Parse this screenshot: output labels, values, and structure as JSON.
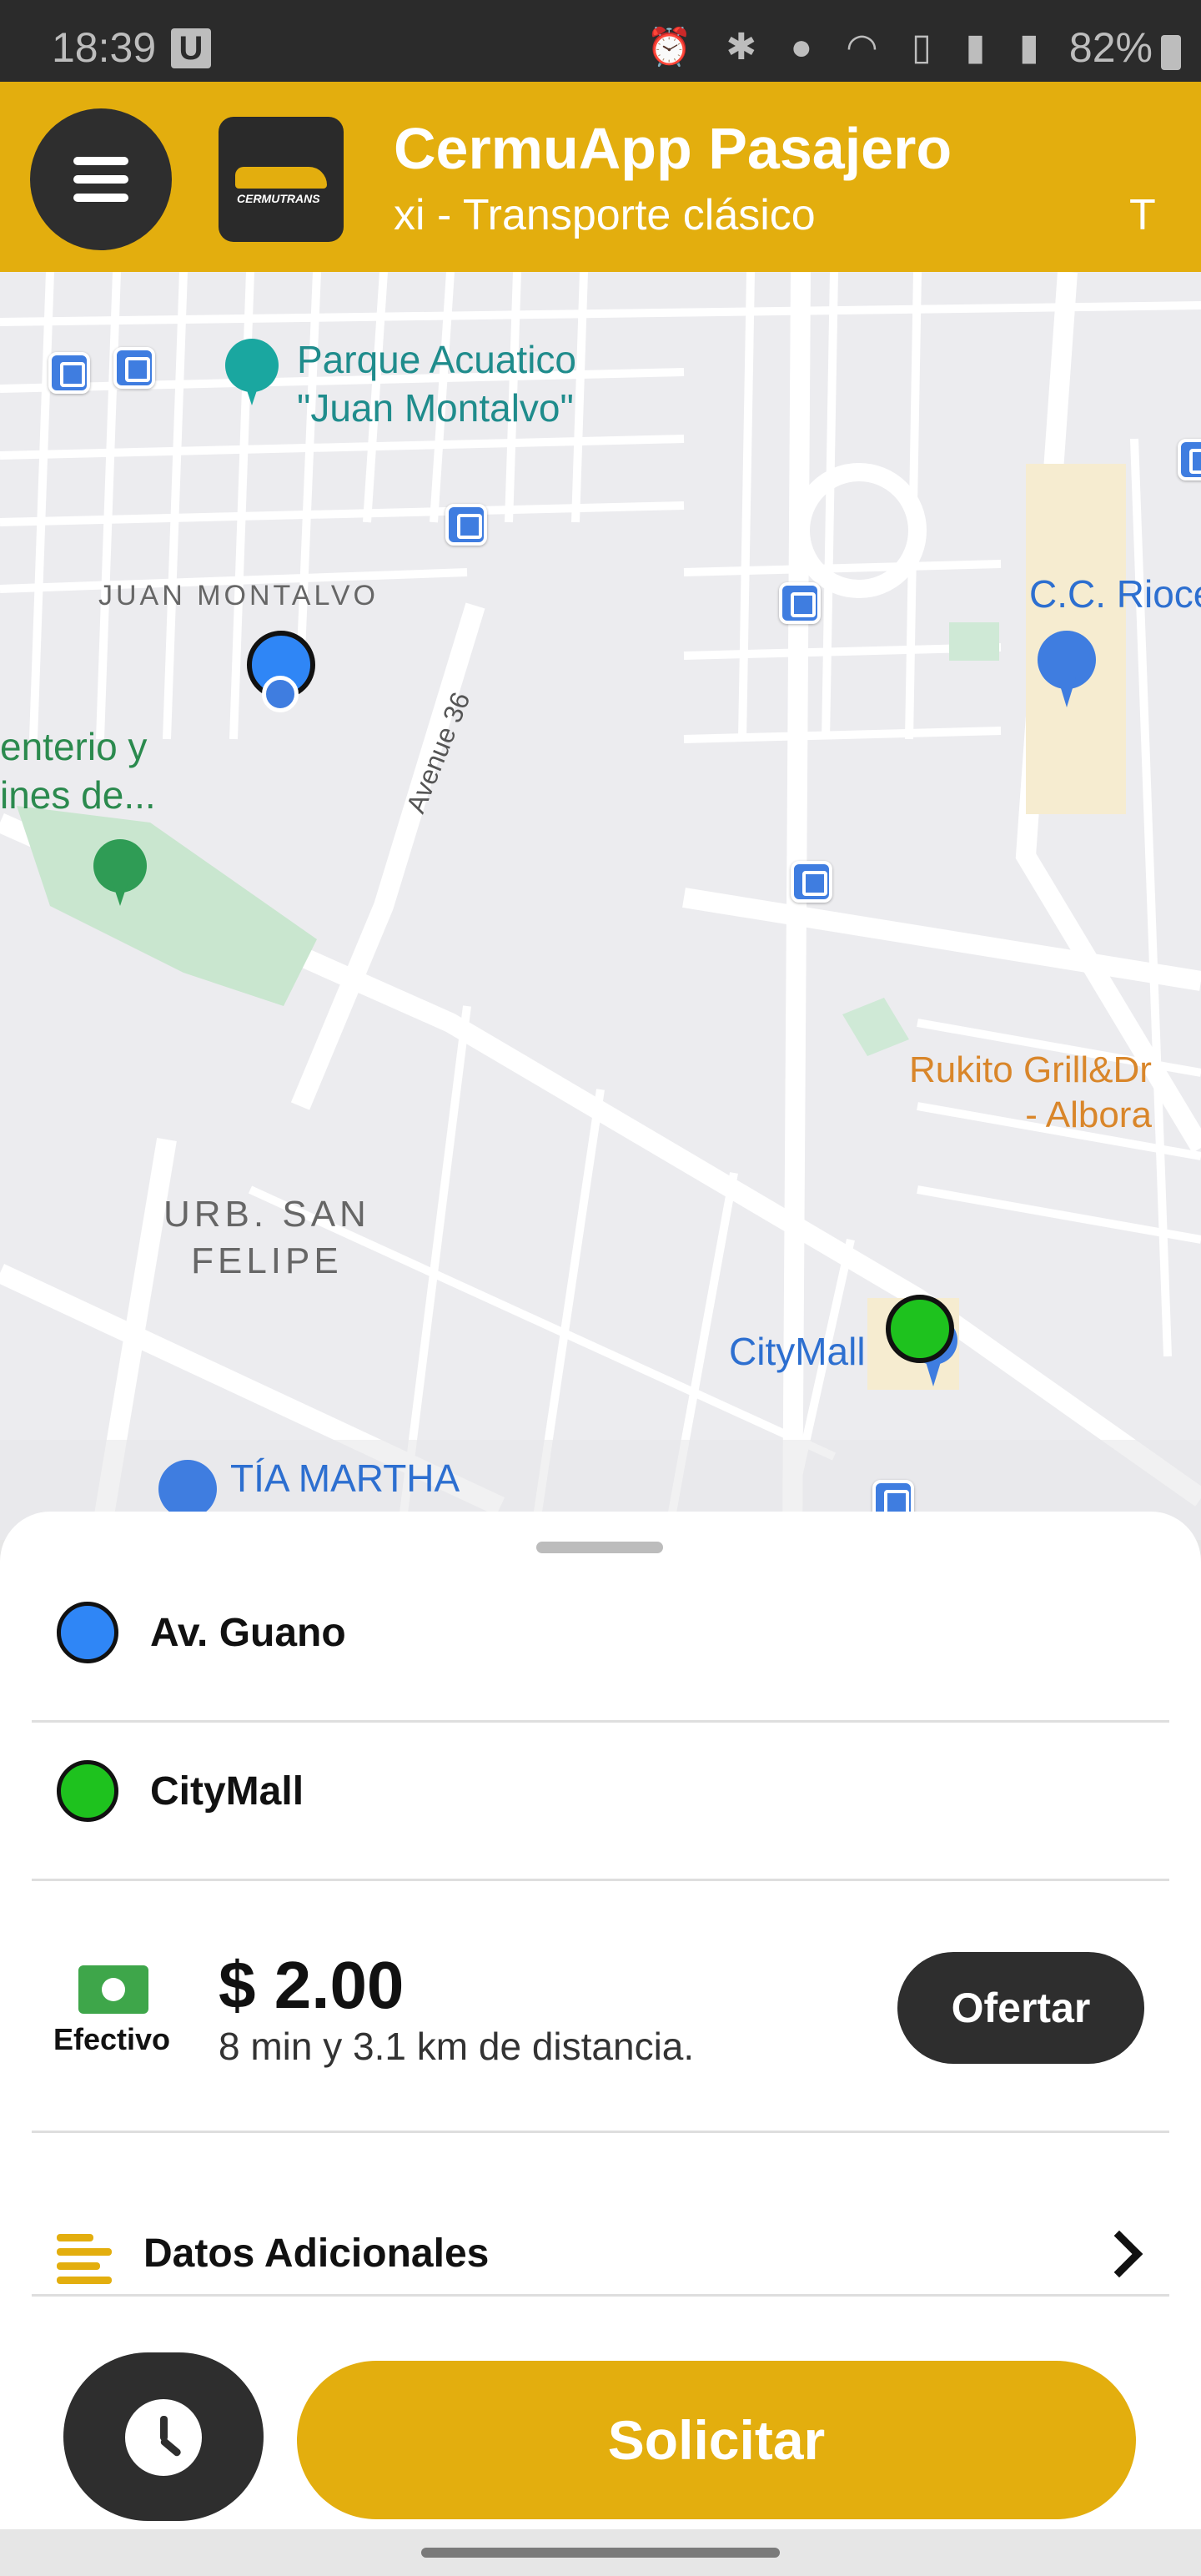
{
  "status_bar": {
    "time": "18:39",
    "badge": "U",
    "icons": [
      "alarm-icon",
      "bluetooth-icon",
      "location-icon",
      "wifi-icon",
      "volte-icon",
      "signal-icon",
      "signal-icon"
    ],
    "battery": "82%"
  },
  "header": {
    "title": "CermuApp Pasajero",
    "subtitle": "xi - Transporte clásico",
    "subtitle_tail": "T",
    "logo_text": "CERMUTRANS",
    "accent_color": "#e3ae0e"
  },
  "map": {
    "labels": {
      "park": "Parque Acuatico\n\"Juan Montalvo\"",
      "juan_montalvo": "JUAN MONTALVO",
      "cemetery": "enterio y\nines de...",
      "avenue": "Avenue 36",
      "cc_rioce": "C.C. Rioce",
      "rukito": "Rukito Grill&Dr\n- Albora",
      "san_felipe": "URB. SAN\nFELIPE",
      "citymall": "CityMall",
      "tia_martha": "TÍA MARTHA"
    },
    "origin_color": "#2f86f6",
    "destination_color": "#1ec21e"
  },
  "trip": {
    "origin": "Av. Guano",
    "destination": "CityMall",
    "payment_method": "Efectivo",
    "price": "$ 2.00",
    "eta": "8 min y 3.1 km de distancia.",
    "offer_label": "Ofertar",
    "extra_label": "Datos Adicionales",
    "request_label": "Solicitar"
  }
}
